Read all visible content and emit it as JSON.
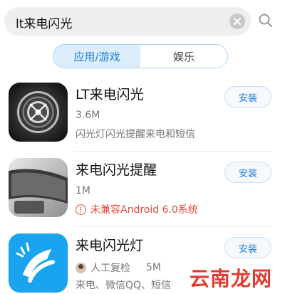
{
  "search": {
    "query": "lt来电闪光"
  },
  "tabs": [
    {
      "label": "应用/游戏",
      "active": true
    },
    {
      "label": "娱乐",
      "active": false
    }
  ],
  "apps": [
    {
      "name": "LT来电闪光",
      "size": "3.6M",
      "description": "闪光灯闪光提醒来电和短信",
      "install_label": "安装"
    },
    {
      "name": "来电闪光提醒",
      "size": "1M",
      "warning": "未兼容Android 6.0系统",
      "install_label": "安装"
    },
    {
      "name": "来电闪光灯",
      "review": "人工复检",
      "size": "5M",
      "description": "来电、微信QQ、短信",
      "install_label": "安装"
    }
  ],
  "watermark": "云南龙网",
  "colors": {
    "accent": "#1a7fd6",
    "warning": "#e54b3c"
  }
}
